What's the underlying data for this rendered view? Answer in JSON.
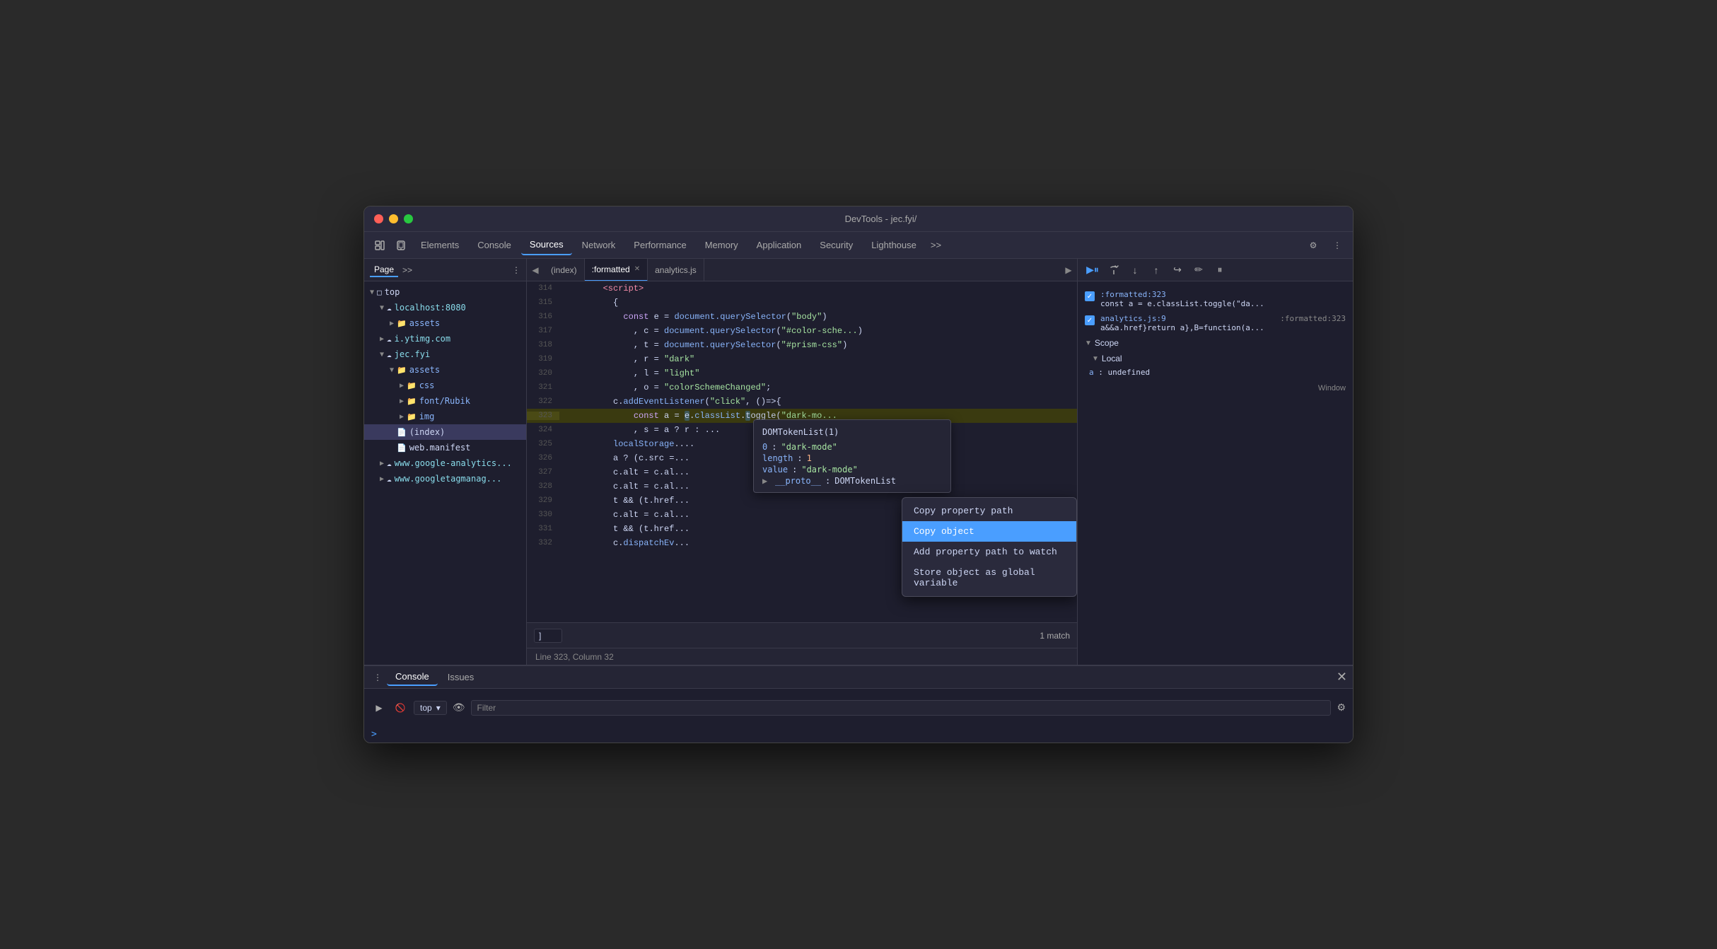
{
  "window": {
    "title": "DevTools - jec.fyi/"
  },
  "tabs": {
    "items": [
      "Elements",
      "Console",
      "Sources",
      "Network",
      "Performance",
      "Memory",
      "Application",
      "Security",
      "Lighthouse"
    ],
    "active": "Sources",
    "more": ">>"
  },
  "sidebar": {
    "page_label": "Page",
    "more": ">>",
    "tree": [
      {
        "label": "top",
        "type": "root",
        "indent": 0,
        "arrow": "▼"
      },
      {
        "label": "localhost:8080",
        "type": "domain",
        "indent": 1,
        "arrow": "▼"
      },
      {
        "label": "assets",
        "type": "folder",
        "indent": 2,
        "arrow": "▶"
      },
      {
        "label": "i.ytimg.com",
        "type": "domain",
        "indent": 1,
        "arrow": "▶"
      },
      {
        "label": "jec.fyi",
        "type": "domain",
        "indent": 1,
        "arrow": "▼"
      },
      {
        "label": "assets",
        "type": "folder",
        "indent": 2,
        "arrow": "▼"
      },
      {
        "label": "css",
        "type": "folder",
        "indent": 3,
        "arrow": "▶"
      },
      {
        "label": "font/Rubik",
        "type": "folder",
        "indent": 3,
        "arrow": "▶"
      },
      {
        "label": "img",
        "type": "folder",
        "indent": 3,
        "arrow": "▶"
      },
      {
        "label": "(index)",
        "type": "file",
        "indent": 2,
        "arrow": ""
      },
      {
        "label": "web.manifest",
        "type": "file",
        "indent": 2,
        "arrow": ""
      },
      {
        "label": "www.google-analytics...",
        "type": "domain",
        "indent": 1,
        "arrow": "▶"
      },
      {
        "label": "www.googletagmanag...",
        "type": "domain",
        "indent": 1,
        "arrow": "▶"
      }
    ]
  },
  "file_tabs": {
    "items": [
      {
        "label": "(index)",
        "active": false,
        "closeable": false
      },
      {
        "label": ":formatted",
        "active": true,
        "closeable": true
      },
      {
        "label": "analytics.js",
        "active": false,
        "closeable": false
      }
    ]
  },
  "code": {
    "lines": [
      {
        "num": "314",
        "content": "        <script>"
      },
      {
        "num": "315",
        "content": "          {"
      },
      {
        "num": "316",
        "content": "            const e = document.querySelector(\"body\")"
      },
      {
        "num": "317",
        "content": "              , c = document.querySelector(\"#color-sche..."
      },
      {
        "num": "318",
        "content": "              , t = document.querySelector(\"#prism-css\")"
      },
      {
        "num": "319",
        "content": "              , r = \"dark\""
      },
      {
        "num": "320",
        "content": "              , l = \"light\""
      },
      {
        "num": "321",
        "content": "              , o = \"colorSchemeChanged\";"
      },
      {
        "num": "322",
        "content": "          c.addEventListener(\"click\", ()=>{"
      },
      {
        "num": "323",
        "content": "              const a = e.classList.toggle(\"dark-mo...",
        "highlighted": true
      },
      {
        "num": "324",
        "content": "              , s = a ? r : ..."
      },
      {
        "num": "325",
        "content": "          localStorage...."
      },
      {
        "num": "326",
        "content": "          a ? (c.src =..."
      },
      {
        "num": "327",
        "content": "          c.alt = c.al..."
      },
      {
        "num": "328",
        "content": "          c.alt = c.al..."
      },
      {
        "num": "329",
        "content": "          t && (t.href..."
      },
      {
        "num": "330",
        "content": "          c.alt = c.al..."
      },
      {
        "num": "331",
        "content": "          t && (t.href..."
      },
      {
        "num": "332",
        "content": "          c.dispatchEv..."
      }
    ]
  },
  "tooltip": {
    "title": "DOMTokenList(1)",
    "rows": [
      {
        "key": "0",
        "colon": ":",
        "val": "\"dark-mode\"",
        "type": "string"
      },
      {
        "key": "length",
        "colon": ":",
        "val": "1",
        "type": "number"
      },
      {
        "key": "value",
        "colon": ":",
        "val": "\"dark-mode\"",
        "type": "string"
      },
      {
        "key": "__proto__",
        "colon": ":",
        "val": "DOMTokenList",
        "type": "proto",
        "has_arrow": true
      }
    ]
  },
  "context_menu": {
    "items": [
      {
        "label": "Copy property path",
        "active": false
      },
      {
        "label": "Copy object",
        "active": true
      },
      {
        "label": "Add property path to watch",
        "active": false
      },
      {
        "label": "Store object as global variable",
        "active": false
      }
    ]
  },
  "right_panel": {
    "breakpoints": [
      {
        "checked": true,
        "filename": ":formatted:323",
        "code": "const a = e.classList.toggle(\"da..."
      },
      {
        "checked": true,
        "filename": "analytics.js:9",
        "code": "a&&a.href}return a},B=function(a..."
      }
    ],
    "scope": {
      "label": "Scope",
      "local_label": "Local",
      "items": [
        {
          "key": "a",
          "val": "undefined"
        }
      ]
    },
    "window_label": "Window",
    "status_right": ":formatted:323"
  },
  "search_bar": {
    "input": "]",
    "match": "1 match"
  },
  "status_bar": {
    "text": "Line 323, Column 32"
  },
  "bottom": {
    "tabs": [
      "Console",
      "Issues"
    ],
    "active_tab": "Console",
    "console_value": "top",
    "filter_placeholder": "Filter",
    "prompt": ">"
  }
}
